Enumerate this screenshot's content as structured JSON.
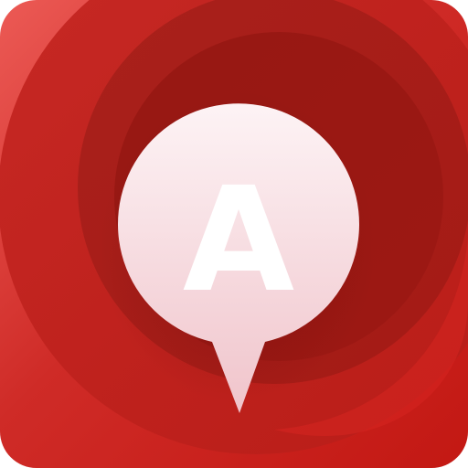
{
  "app_icon": {
    "icon": "map-pin-icon",
    "letter": "A",
    "colors": {
      "red_light": "#e8504c",
      "red_main": "#cc2a26",
      "red_deep": "#a91c17",
      "red_darkest": "#8f1410",
      "pin_top": "#fdf1f3",
      "pin_bottom": "#f2c9cf",
      "letter": "#ffffff"
    }
  }
}
